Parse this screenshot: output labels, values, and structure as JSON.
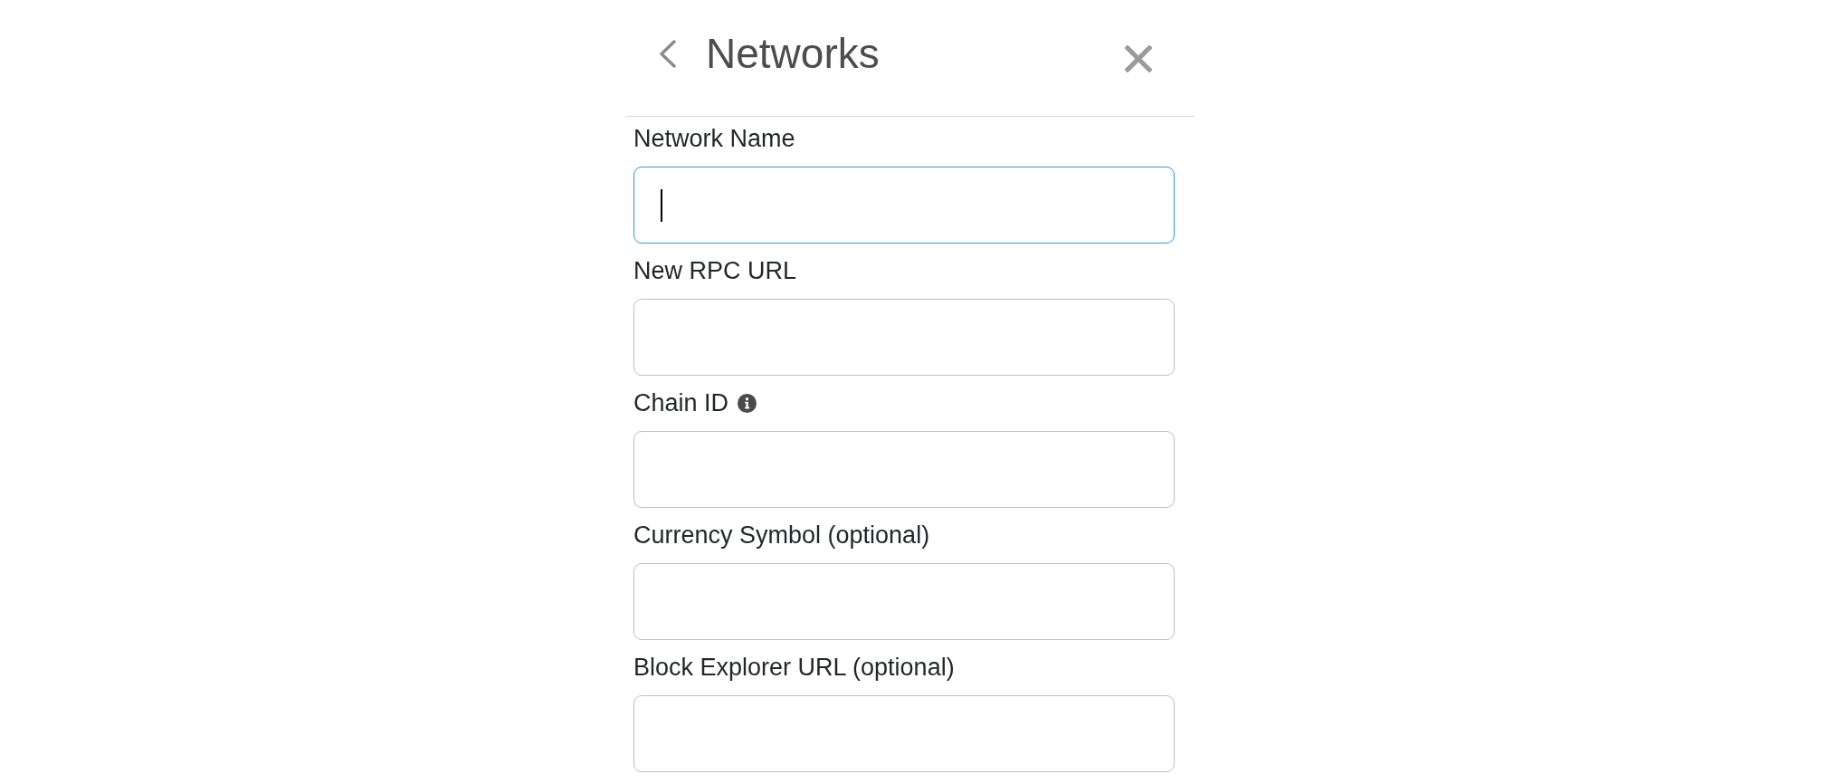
{
  "header": {
    "title": "Networks"
  },
  "fields": [
    {
      "label": "Network Name",
      "focused": true,
      "info": false
    },
    {
      "label": "New RPC URL",
      "focused": false,
      "info": false
    },
    {
      "label": "Chain ID",
      "focused": false,
      "info": true
    },
    {
      "label": "Currency Symbol (optional)",
      "focused": false,
      "info": false
    },
    {
      "label": "Block Explorer URL (optional)",
      "focused": false,
      "info": false
    }
  ]
}
